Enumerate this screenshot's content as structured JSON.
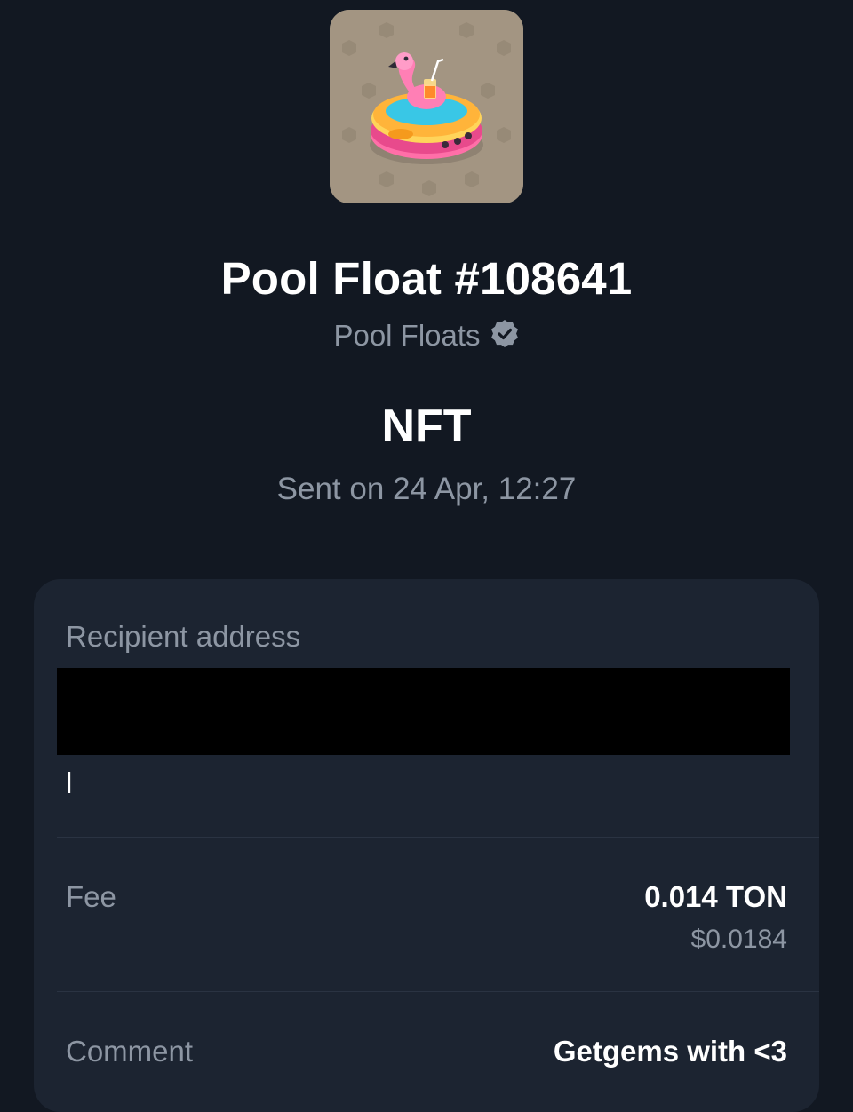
{
  "nft": {
    "name": "Pool Float #108641",
    "collection": "Pool Floats",
    "collection_verified": true,
    "image_icon": "pool-float-flamingo-icon"
  },
  "transaction": {
    "type": "NFT",
    "date_text": "Sent on 24 Apr, 12:27"
  },
  "details": {
    "recipient_label": "Recipient address",
    "recipient_visible_tail": "l",
    "fee_label": "Fee",
    "fee_value": "0.014 TON",
    "fee_usd": "$0.0184",
    "comment_label": "Comment",
    "comment_value": "Getgems with <3"
  },
  "colors": {
    "background": "#121822",
    "card": "#1c2431",
    "muted_text": "#8d96a3",
    "primary_text": "#ffffff"
  }
}
